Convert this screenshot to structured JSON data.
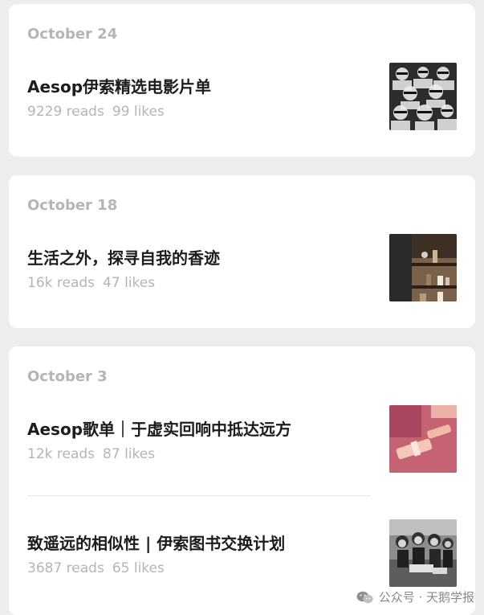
{
  "articles_group_1": {
    "date": "October 24",
    "items": [
      {
        "title": "Aesop伊索精选电影片单",
        "reads": "9229 reads",
        "likes": "99 likes",
        "thumb_icon": "3d-cinema-audience-photo"
      }
    ]
  },
  "articles_group_2": {
    "date": "October 18",
    "items": [
      {
        "title": "生活之外，探寻自我的香迹",
        "reads": "16k reads",
        "likes": "47 likes",
        "thumb_icon": "shelf-with-bottles-photo"
      }
    ]
  },
  "articles_group_3": {
    "date": "October 3",
    "items": [
      {
        "title": "Aesop歌单｜于虚实回响中抵达远方",
        "reads": "12k reads",
        "likes": "87 likes",
        "thumb_icon": "pink-abstract-photo"
      },
      {
        "title": "致遥远的相似性 | 伊索图书交换计划",
        "reads": "3687 reads",
        "likes": "65 likes",
        "thumb_icon": "children-reading-photo"
      }
    ]
  },
  "watermark": {
    "icon": "wechat-icon",
    "text": "公众号 · 天鹅学报"
  },
  "colors": {
    "background": "#ededed",
    "card": "#ffffff",
    "muted_text": "#b5b5b5",
    "title_text": "#1c1c1c"
  }
}
